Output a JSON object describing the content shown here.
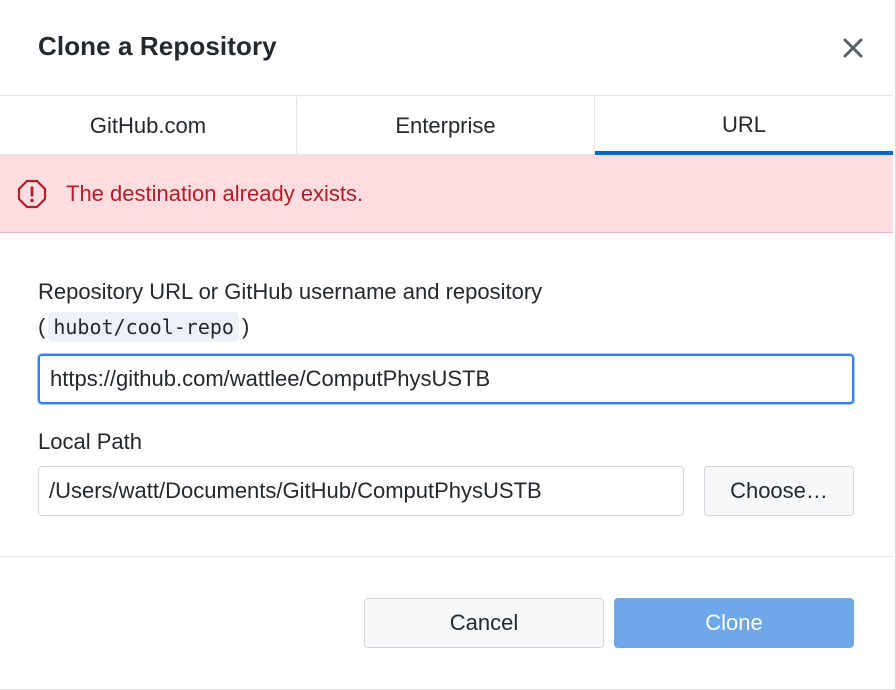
{
  "dialog": {
    "title": "Clone a Repository",
    "close_icon": "close-icon"
  },
  "tabs": [
    {
      "label": "GitHub.com",
      "selected": false
    },
    {
      "label": "Enterprise",
      "selected": false
    },
    {
      "label": "URL",
      "selected": true
    }
  ],
  "error": {
    "icon": "alert-circle-icon",
    "message": "The destination already exists."
  },
  "form": {
    "repo_label": "Repository URL or GitHub username and repository",
    "hint_open": "(",
    "hint_code": "hubot/cool-repo",
    "hint_close": ")",
    "repo_url_value": "https://github.com/wattlee/ComputPhysUSTB",
    "local_path_label": "Local Path",
    "local_path_value": "/Users/watt/Documents/GitHub/ComputPhysUSTB",
    "choose_label": "Choose…"
  },
  "footer": {
    "cancel_label": "Cancel",
    "clone_label": "Clone"
  },
  "colors": {
    "accent": "#0366d6",
    "error_bg": "#ffdce0",
    "error_text": "#b31d28",
    "clone_disabled_bg": "#6ea8e8"
  }
}
